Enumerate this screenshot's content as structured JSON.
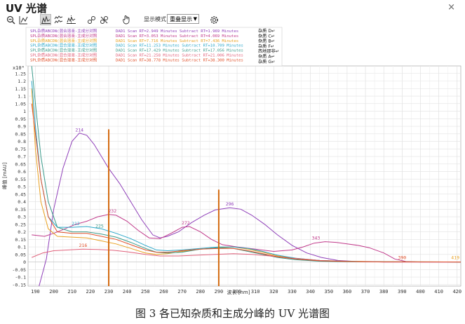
{
  "window": {
    "title": "UV 光谱",
    "close_glyph": "×"
  },
  "toolbar": {
    "display_mode_label": "显示模式",
    "display_mode_value": "重叠显示",
    "icons": [
      "zoom-out-icon",
      "autoscale-icon",
      "overlay-view-icon",
      "stack-view-icon",
      "split-view-icon",
      "link-icon",
      "unlink-icon",
      "hand-pointer-icon",
      "settings-gear-icon"
    ]
  },
  "legend": {
    "sample_entries": [
      {
        "left": "SPL杂质ABCDN(混合溶液-主成分对照",
        "right": "DAD1 Scan RT=2.949 Minutes Subtract RT=1.969 Minutes",
        "color": "#8f3fb9"
      },
      {
        "left": "SPL杂质ABCDN(混合溶液-主成分对照",
        "right": "DAD1 Scan RT=3.053 Minutes Subtract RT=4.069 Minutes",
        "color": "#c0398a"
      },
      {
        "left": "SPL杂质ABCDN(混合溶液-主成分对照",
        "right": "DAD1 Scan RT=7.716 Minutes Subtract RT=7.436 Minutes",
        "color": "#e8a020"
      },
      {
        "left": "SPL杂质ABCDN(混合溶液-主成分对照",
        "right": "DAD1 Scan RT=11.253 Minutes Subtract RT=10.709 Minutes",
        "color": "#2ba7c9"
      },
      {
        "left": "SPL杂质ABCDN(混合溶液-主成分对照",
        "right": "DAD1 Scan RT=17.429 Minutes Subtract RT=17.056 Minutes",
        "color": "#3a9a8a"
      },
      {
        "left": "SPL杂质ABCDN(混合溶液-主成分对照",
        "right": "DAD1 Scan RT=21.258 Minutes Subtract RT=21.006 Minutes",
        "color": "#e0607a"
      },
      {
        "left": "SPL杂质ABCDN(混合溶液-主成分对照",
        "right": "DAD1 Scan RT=38.778 Minutes Subtract RT=38.300 Minutes",
        "color": "#e0502a"
      }
    ],
    "name_entries": [
      "杂质 D↵",
      "杂质 C↵",
      "杂质 B↵",
      "杂质 F↵",
      "西地那非↵",
      "杂质 A↵",
      "杂质 G↵"
    ]
  },
  "chart_data": {
    "type": "line",
    "title": "",
    "xlabel": "波长 [nm]",
    "ylabel": "峰值 [mAU]",
    "y_multiplier_label": "x10⁴",
    "xlim": [
      186,
      422
    ],
    "ylim": [
      -0.16,
      1.3
    ],
    "x_ticks": [
      190,
      200,
      210,
      220,
      230,
      240,
      250,
      260,
      270,
      280,
      290,
      300,
      310,
      320,
      330,
      340,
      350,
      360,
      370,
      380,
      390,
      400,
      410,
      420
    ],
    "y_ticks": [
      -0.15,
      -0.1,
      -0.05,
      0,
      0.05,
      0.1,
      0.15,
      0.2,
      0.25,
      0.3,
      0.35,
      0.4,
      0.45,
      0.5,
      0.55,
      0.6,
      0.65,
      0.7,
      0.75,
      0.8,
      0.85,
      0.9,
      0.95,
      1,
      1.05,
      1.1,
      1.15,
      1.2,
      1.25
    ],
    "y_tick_labels": [
      "-0.15",
      "-0.1",
      "-0.05",
      "0",
      "0.05",
      "0.1",
      "0.15",
      "0.2",
      "0.25",
      "0.3",
      "0.35",
      "0.4",
      "0.45",
      "0.5",
      "0.55",
      "0.6",
      "0.65",
      "0.7",
      "0.75",
      "0.8",
      "0.85",
      "0.9",
      "0.95",
      "1",
      "1.05",
      "1.1",
      "1.15",
      "1.2",
      "1.25"
    ],
    "grid": true,
    "series": [
      {
        "color": "#8f3fb9",
        "points": [
          [
            192,
            -0.16
          ],
          [
            196,
            0.02
          ],
          [
            200,
            0.35
          ],
          [
            205,
            0.62
          ],
          [
            210,
            0.8
          ],
          [
            214,
            0.855
          ],
          [
            218,
            0.84
          ],
          [
            222,
            0.78
          ],
          [
            226,
            0.7
          ],
          [
            230,
            0.62
          ],
          [
            236,
            0.52
          ],
          [
            242,
            0.4
          ],
          [
            248,
            0.28
          ],
          [
            254,
            0.18
          ],
          [
            258,
            0.16
          ],
          [
            262,
            0.17
          ],
          [
            268,
            0.2
          ],
          [
            275,
            0.26
          ],
          [
            282,
            0.31
          ],
          [
            288,
            0.345
          ],
          [
            296,
            0.36
          ],
          [
            302,
            0.35
          ],
          [
            308,
            0.31
          ],
          [
            315,
            0.25
          ],
          [
            322,
            0.18
          ],
          [
            330,
            0.11
          ],
          [
            338,
            0.06
          ],
          [
            346,
            0.03
          ],
          [
            355,
            0.01
          ],
          [
            365,
            0.003
          ],
          [
            380,
            0
          ],
          [
            400,
            0
          ],
          [
            422,
            0
          ]
        ]
      },
      {
        "color": "#c0398a",
        "points": [
          [
            188,
            0.18
          ],
          [
            195,
            0.17
          ],
          [
            200,
            0.19
          ],
          [
            206,
            0.22
          ],
          [
            212,
            0.25
          ],
          [
            218,
            0.27
          ],
          [
            224,
            0.3
          ],
          [
            230,
            0.315
          ],
          [
            234,
            0.31
          ],
          [
            240,
            0.27
          ],
          [
            246,
            0.21
          ],
          [
            252,
            0.16
          ],
          [
            258,
            0.155
          ],
          [
            264,
            0.19
          ],
          [
            270,
            0.23
          ],
          [
            274,
            0.235
          ],
          [
            280,
            0.2
          ],
          [
            286,
            0.15
          ],
          [
            292,
            0.115
          ],
          [
            300,
            0.1
          ],
          [
            310,
            0.085
          ],
          [
            320,
            0.07
          ],
          [
            330,
            0.08
          ],
          [
            336,
            0.1
          ],
          [
            342,
            0.125
          ],
          [
            348,
            0.135
          ],
          [
            354,
            0.13
          ],
          [
            360,
            0.12
          ],
          [
            366,
            0.11
          ],
          [
            372,
            0.095
          ],
          [
            380,
            0.06
          ],
          [
            386,
            0.02
          ],
          [
            392,
            0.003
          ],
          [
            400,
            0
          ],
          [
            422,
            0
          ]
        ]
      },
      {
        "color": "#e8a020",
        "points": [
          [
            188,
            1.15
          ],
          [
            190,
            0.75
          ],
          [
            193,
            0.4
          ],
          [
            197,
            0.22
          ],
          [
            202,
            0.17
          ],
          [
            210,
            0.165
          ],
          [
            218,
            0.16
          ],
          [
            226,
            0.14
          ],
          [
            234,
            0.12
          ],
          [
            242,
            0.09
          ],
          [
            250,
            0.06
          ],
          [
            256,
            0.05
          ],
          [
            262,
            0.055
          ],
          [
            270,
            0.07
          ],
          [
            280,
            0.085
          ],
          [
            290,
            0.095
          ],
          [
            298,
            0.1
          ],
          [
            306,
            0.085
          ],
          [
            314,
            0.065
          ],
          [
            322,
            0.04
          ],
          [
            332,
            0.025
          ],
          [
            345,
            0.01
          ],
          [
            360,
            0.005
          ],
          [
            380,
            0.002
          ],
          [
            400,
            0.001
          ],
          [
            422,
            0
          ]
        ]
      },
      {
        "color": "#2ba7c9",
        "points": [
          [
            188,
            1.2
          ],
          [
            190,
            0.9
          ],
          [
            193,
            0.55
          ],
          [
            197,
            0.3
          ],
          [
            202,
            0.23
          ],
          [
            210,
            0.23
          ],
          [
            218,
            0.235
          ],
          [
            226,
            0.22
          ],
          [
            234,
            0.19
          ],
          [
            242,
            0.155
          ],
          [
            250,
            0.11
          ],
          [
            256,
            0.08
          ],
          [
            262,
            0.075
          ],
          [
            270,
            0.08
          ],
          [
            280,
            0.09
          ],
          [
            290,
            0.1
          ],
          [
            298,
            0.1
          ],
          [
            306,
            0.09
          ],
          [
            314,
            0.07
          ],
          [
            322,
            0.045
          ],
          [
            332,
            0.025
          ],
          [
            345,
            0.01
          ],
          [
            360,
            0.004
          ],
          [
            380,
            0.001
          ],
          [
            422,
            0
          ]
        ]
      },
      {
        "color": "#3a9a8a",
        "points": [
          [
            188,
            1.3
          ],
          [
            190,
            1.05
          ],
          [
            193,
            0.7
          ],
          [
            197,
            0.4
          ],
          [
            202,
            0.23
          ],
          [
            210,
            0.2
          ],
          [
            218,
            0.2
          ],
          [
            226,
            0.185
          ],
          [
            234,
            0.165
          ],
          [
            242,
            0.13
          ],
          [
            250,
            0.09
          ],
          [
            256,
            0.065
          ],
          [
            262,
            0.06
          ],
          [
            270,
            0.065
          ],
          [
            280,
            0.085
          ],
          [
            290,
            0.095
          ],
          [
            298,
            0.09
          ],
          [
            306,
            0.07
          ],
          [
            314,
            0.05
          ],
          [
            322,
            0.03
          ],
          [
            332,
            0.015
          ],
          [
            345,
            0.005
          ],
          [
            360,
            0.002
          ],
          [
            422,
            0
          ]
        ]
      },
      {
        "color": "#e0607a",
        "points": [
          [
            188,
            0.03
          ],
          [
            194,
            0.06
          ],
          [
            200,
            0.075
          ],
          [
            208,
            0.08
          ],
          [
            216,
            0.085
          ],
          [
            224,
            0.083
          ],
          [
            232,
            0.078
          ],
          [
            240,
            0.068
          ],
          [
            250,
            0.05
          ],
          [
            258,
            0.04
          ],
          [
            268,
            0.04
          ],
          [
            278,
            0.045
          ],
          [
            288,
            0.05
          ],
          [
            298,
            0.055
          ],
          [
            308,
            0.05
          ],
          [
            318,
            0.04
          ],
          [
            330,
            0.025
          ],
          [
            345,
            0.01
          ],
          [
            360,
            0.003
          ],
          [
            380,
            0
          ],
          [
            422,
            0
          ]
        ]
      },
      {
        "color": "#e0502a",
        "points": [
          [
            188,
            1.05
          ],
          [
            190,
            0.85
          ],
          [
            193,
            0.55
          ],
          [
            197,
            0.3
          ],
          [
            202,
            0.2
          ],
          [
            210,
            0.19
          ],
          [
            218,
            0.19
          ],
          [
            226,
            0.17
          ],
          [
            234,
            0.15
          ],
          [
            242,
            0.115
          ],
          [
            250,
            0.08
          ],
          [
            256,
            0.065
          ],
          [
            262,
            0.065
          ],
          [
            270,
            0.075
          ],
          [
            280,
            0.085
          ],
          [
            290,
            0.09
          ],
          [
            298,
            0.09
          ],
          [
            306,
            0.075
          ],
          [
            314,
            0.055
          ],
          [
            322,
            0.035
          ],
          [
            332,
            0.02
          ],
          [
            345,
            0.008
          ],
          [
            360,
            0.003
          ],
          [
            380,
            0.001
          ],
          [
            422,
            0
          ]
        ]
      }
    ],
    "peak_labels": [
      {
        "text": "214",
        "x": 214,
        "y": 0.855,
        "color": "#8f3fb9"
      },
      {
        "text": "232",
        "x": 232,
        "y": 0.32,
        "color": "#c0398a"
      },
      {
        "text": "212",
        "x": 212,
        "y": 0.235,
        "color": "#2ba7c9"
      },
      {
        "text": "225",
        "x": 225,
        "y": 0.22,
        "color": "#3a9a8a"
      },
      {
        "text": "216",
        "x": 216,
        "y": 0.09,
        "color": "#e0502a"
      },
      {
        "text": "272",
        "x": 272,
        "y": 0.24,
        "color": "#c0398a"
      },
      {
        "text": "296",
        "x": 296,
        "y": 0.365,
        "color": "#8f3fb9"
      },
      {
        "text": "343",
        "x": 343,
        "y": 0.14,
        "color": "#c0398a"
      },
      {
        "text": "390",
        "x": 390,
        "y": 0.01,
        "color": "#e0502a"
      },
      {
        "text": "419",
        "x": 419,
        "y": 0.01,
        "color": "#e8a020"
      }
    ],
    "vertical_markers": [
      {
        "x": 230,
        "y_bottom": -0.16,
        "y_top": 0.88,
        "color": "#d46a10"
      },
      {
        "x": 290,
        "y_bottom": -0.16,
        "y_top": 0.48,
        "color": "#d46a10"
      }
    ]
  },
  "caption": "图 3 各已知杂质和主成分峰的 UV 光谱图"
}
